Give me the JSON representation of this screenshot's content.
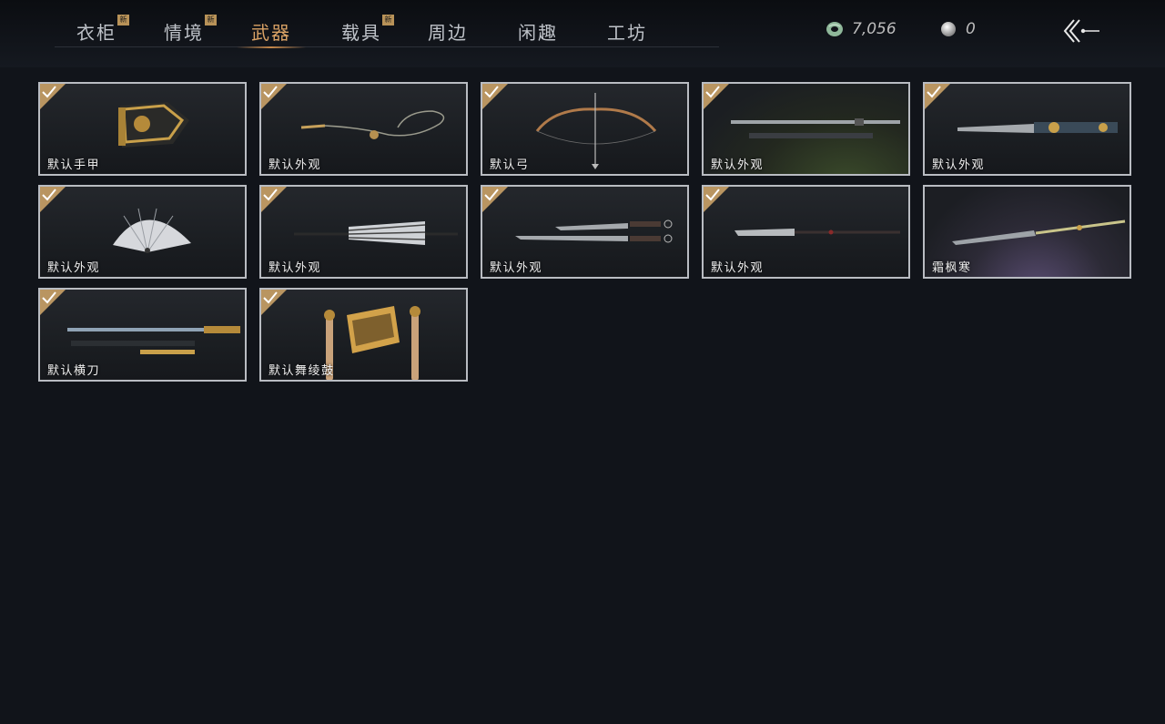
{
  "tabs": [
    {
      "label": "衣柜",
      "badge": "新"
    },
    {
      "label": "情境",
      "badge": "新"
    },
    {
      "label": "武器",
      "badge": ""
    },
    {
      "label": "载具",
      "badge": "新"
    },
    {
      "label": "周边",
      "badge": ""
    },
    {
      "label": "闲趣",
      "badge": ""
    },
    {
      "label": "工坊",
      "badge": ""
    }
  ],
  "active_tab": "武器",
  "currency": {
    "jade": {
      "value": "7,056",
      "icon": "jade-coin-icon"
    },
    "pearl": {
      "value": "0",
      "icon": "pearl-icon"
    }
  },
  "items": [
    {
      "label": "默认手甲",
      "icon": "gauntlet-icon",
      "owned": true
    },
    {
      "label": "默认外观",
      "icon": "rope-dart-icon",
      "owned": true
    },
    {
      "label": "默认弓",
      "icon": "bow-icon",
      "owned": true
    },
    {
      "label": "默认外观",
      "icon": "sword-and-scabbard-icon",
      "owned": true
    },
    {
      "label": "默认外观",
      "icon": "ornate-blade-icon",
      "owned": true
    },
    {
      "label": "默认外观",
      "icon": "folding-fan-icon",
      "owned": true
    },
    {
      "label": "默认外观",
      "icon": "umbrella-icon",
      "owned": true
    },
    {
      "label": "默认外观",
      "icon": "twin-blades-icon",
      "owned": true
    },
    {
      "label": "默认外观",
      "icon": "spear-icon",
      "owned": true
    },
    {
      "label": "霜枫寒",
      "icon": "frost-spear-icon",
      "owned": false
    },
    {
      "label": "默认横刀",
      "icon": "horizontal-sabre-icon",
      "owned": true
    },
    {
      "label": "默认舞绫鼓",
      "icon": "drum-icon",
      "owned": true
    }
  ],
  "colors": {
    "accent": "#d9a265",
    "background": "#11141a",
    "card_border": "#b9bcc2",
    "check_badge": "#b99561"
  }
}
